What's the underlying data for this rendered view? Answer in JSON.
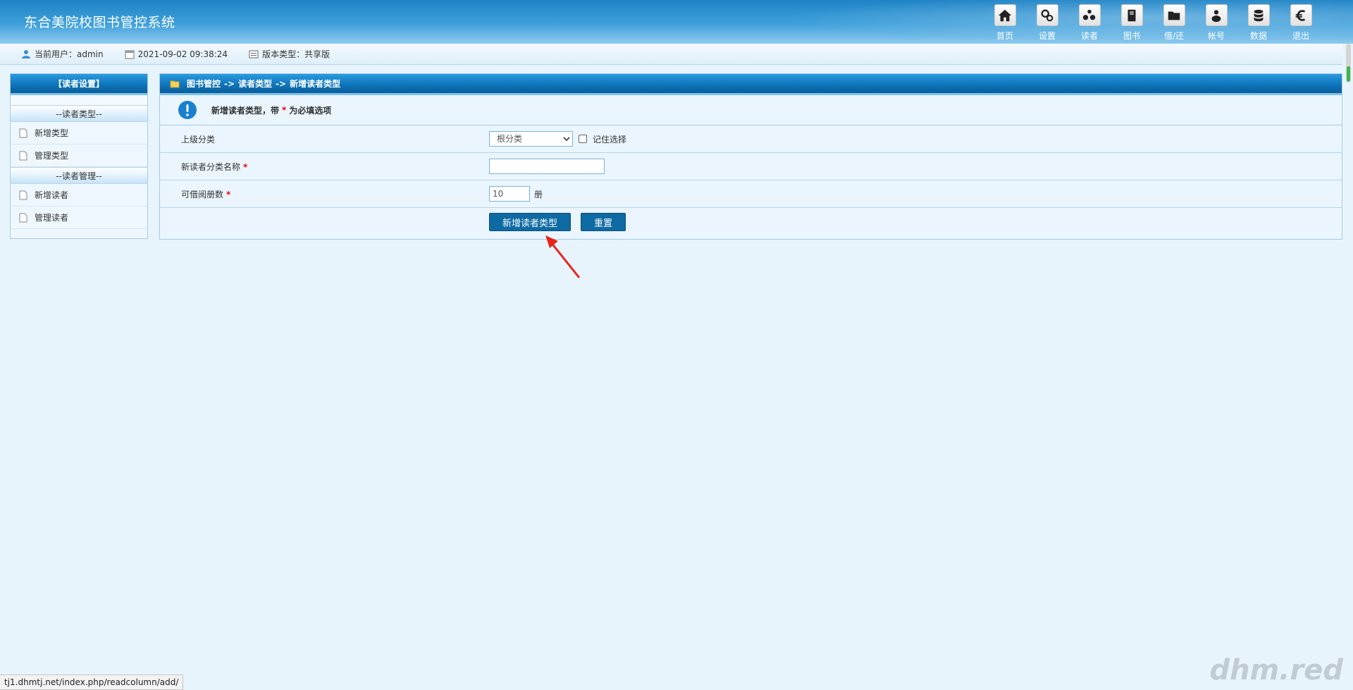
{
  "header": {
    "title": "东合美院校图书管控系统",
    "nav": [
      {
        "label": "首页",
        "icon": "home-icon"
      },
      {
        "label": "设置",
        "icon": "gears-icon"
      },
      {
        "label": "读者",
        "icon": "users-icon"
      },
      {
        "label": "图书",
        "icon": "book-icon"
      },
      {
        "label": "借/还",
        "icon": "folder-icon"
      },
      {
        "label": "帐号",
        "icon": "account-icon"
      },
      {
        "label": "数据",
        "icon": "database-icon"
      },
      {
        "label": "退出",
        "icon": "euro-icon"
      }
    ]
  },
  "infobar": {
    "user": "当前用户：admin",
    "datetime": "2021-09-02 09:38:24",
    "version": "版本类型：共享版"
  },
  "sidebar": {
    "title": "【读者设置】",
    "groups": [
      {
        "title": "--读者类型--",
        "items": [
          "新增类型",
          "管理类型"
        ]
      },
      {
        "title": "--读者管理--",
        "items": [
          "新增读者",
          "管理读者"
        ]
      }
    ]
  },
  "main": {
    "breadcrumb": [
      "图书管控",
      "->",
      "读者类型",
      "->",
      "新增读者类型"
    ],
    "notice_before": "新增读者类型，带",
    "notice_star": "*",
    "notice_after": "为必填选项",
    "form": {
      "parent_label": "上级分类",
      "parent_value": "根分类",
      "remember_label": "记住选择",
      "name_label": "新读者分类名称",
      "name_value": "",
      "borrow_label": "可借阅册数",
      "borrow_value": "10",
      "borrow_unit": "册",
      "required_mark": "*"
    },
    "buttons": {
      "submit": "新增读者类型",
      "reset": "重置"
    }
  },
  "statusbar": {
    "url": "tj1.dhmtj.net/index.php/readcolumn/add/"
  },
  "watermark": "dhm.red",
  "colors": {
    "header": "#1e83c6",
    "bar": "#0d72b7",
    "button": "#0e6aa2",
    "required": "#ee0000",
    "annotation_arrow": "#e8231c"
  }
}
